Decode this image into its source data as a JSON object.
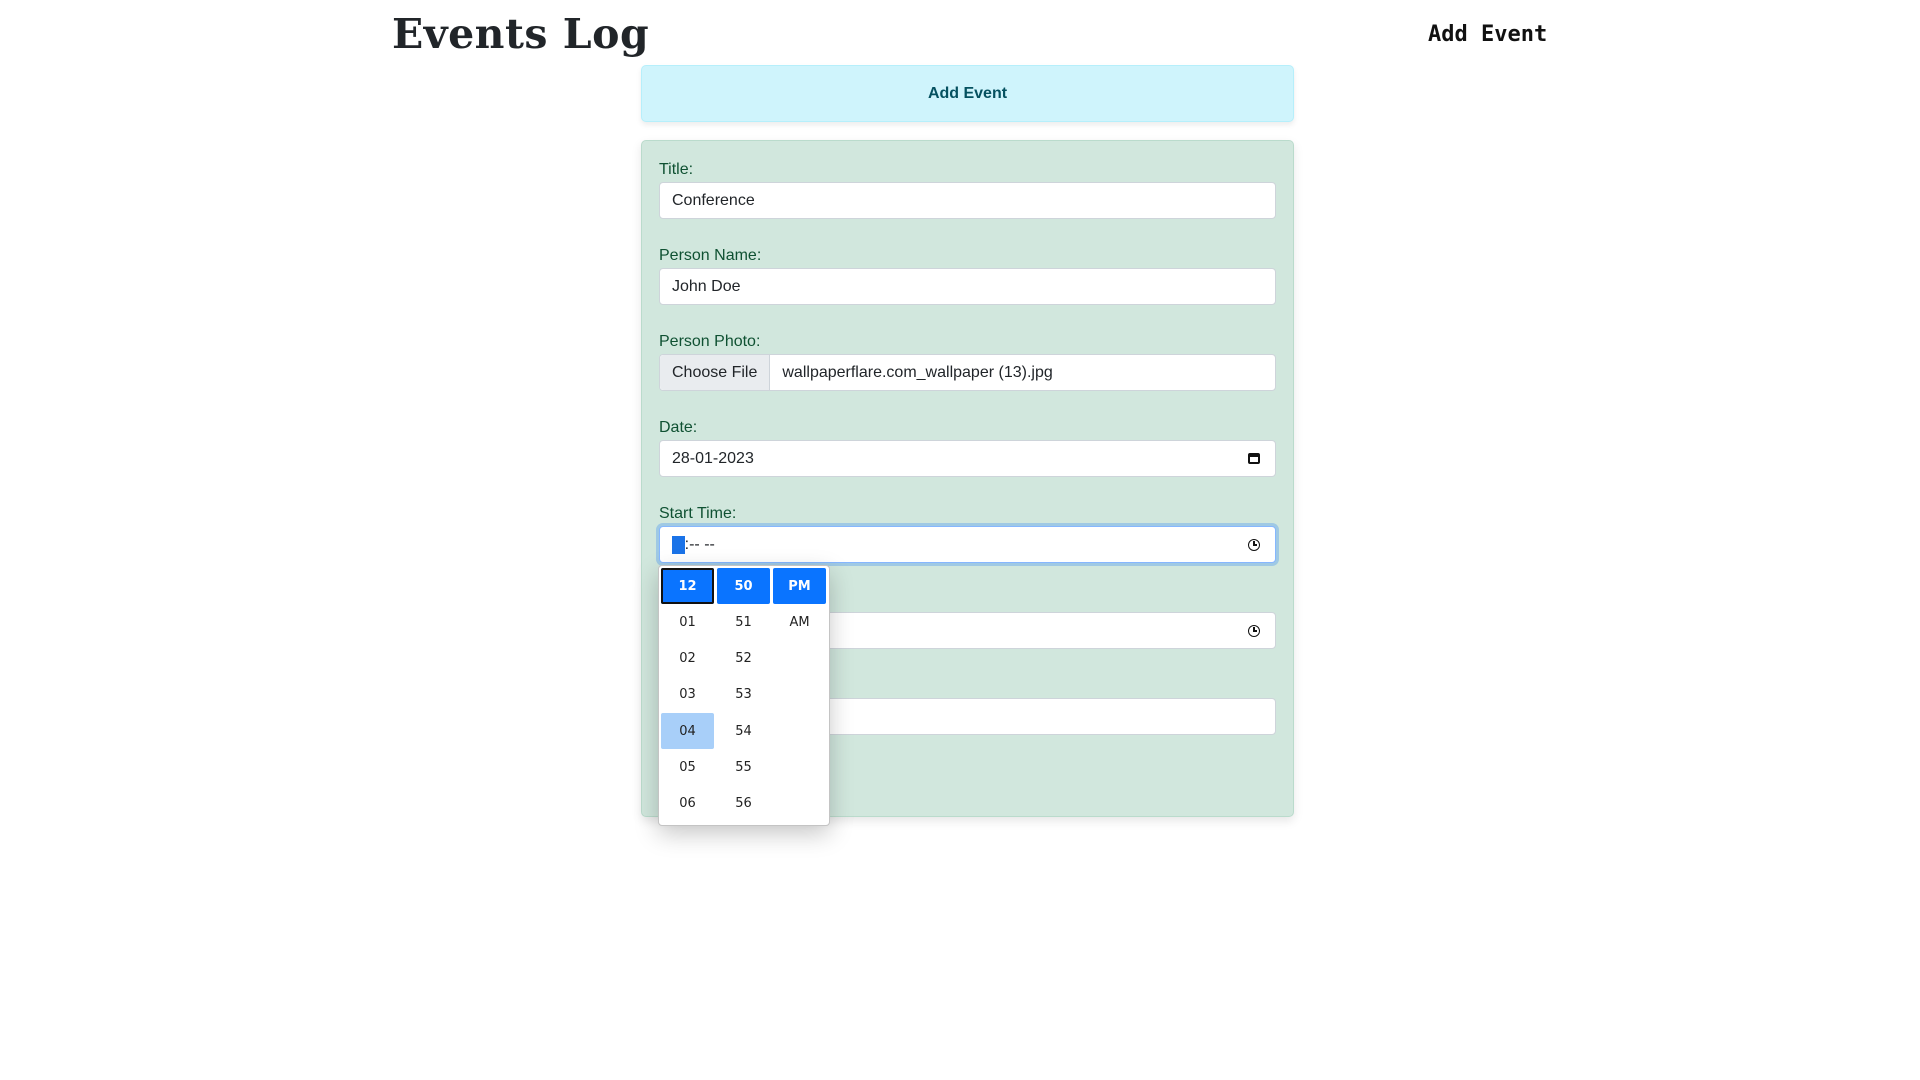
{
  "navbar": {
    "brand": "Events Log",
    "link": "Add Event"
  },
  "header_card": {
    "title": "Add Event"
  },
  "form": {
    "title_label": "Title:",
    "title_value": "Conference",
    "person_label": "Person Name:",
    "person_value": "John Doe",
    "photo_label": "Person Photo:",
    "photo_button": "Choose File",
    "photo_file": "wallpaperflare.com_wallpaper (13).jpg",
    "date_label": "Date:",
    "date_value": "28-01-2023",
    "start_label": "Start Time:",
    "start_hour_placeholder": "--",
    "start_rest_placeholder": ":-- --",
    "date_icon": "calendar-icon",
    "time_icon": "clock-icon"
  },
  "time_picker": {
    "hours": [
      "12",
      "01",
      "02",
      "03",
      "04",
      "05",
      "06"
    ],
    "minutes": [
      "50",
      "51",
      "52",
      "53",
      "54",
      "55",
      "56"
    ],
    "periods": [
      "PM",
      "AM"
    ],
    "selected_hour": "12",
    "selected_minute": "50",
    "selected_period": "PM",
    "hovered_hour": "04"
  },
  "colors": {
    "header_bg": "#cff4fc",
    "form_bg": "#d1e7dd",
    "selected_blue": "#0a74ff",
    "hover_blue": "#a8cff9"
  }
}
